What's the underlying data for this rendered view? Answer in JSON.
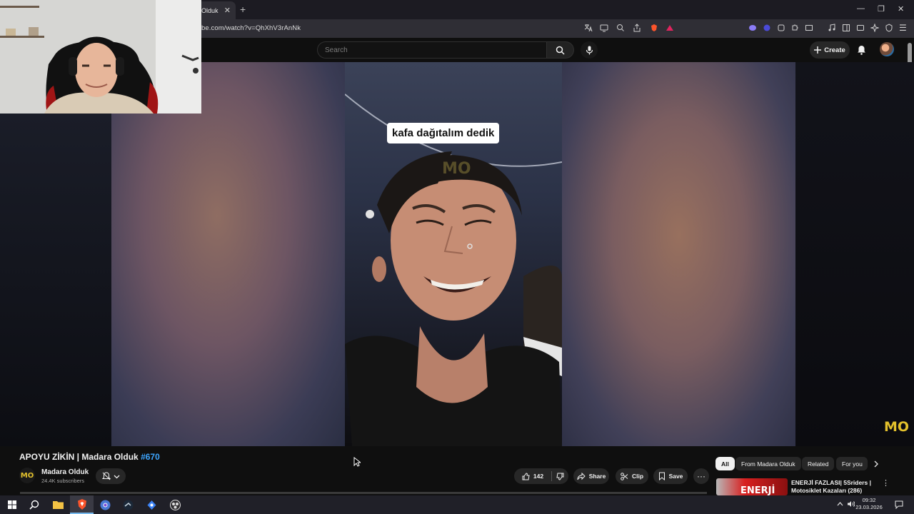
{
  "browser": {
    "tab_title": "Olduk",
    "tab_close": "✕",
    "new_tab": "+",
    "url": "be.com/watch?v=QhXhV3rAnNk",
    "window_controls": [
      "—",
      "❐",
      "✕"
    ],
    "menu_icon": "☰"
  },
  "youtube_header": {
    "search_placeholder": "Search",
    "create_label": "Create"
  },
  "video": {
    "caption": "kafa dağıtalım dedik",
    "watermark": "MO",
    "watermark_corner": "MO"
  },
  "below_video": {
    "title": "APOYU ZİKİN | Madara Olduk",
    "hashtag": "#670",
    "channel_avatar_text": "MO",
    "channel_name": "Madara Olduk",
    "subscribers": "24.4K subscribers",
    "like_count": "142",
    "share_label": "Share",
    "clip_label": "Clip",
    "save_label": "Save",
    "more_label": "···"
  },
  "chips": [
    "All",
    "From Madara Olduk",
    "Related",
    "For you"
  ],
  "related": {
    "thumb_text": "ENERJİ",
    "title": "ENERJİ FAZLASI| 5Sriders | Motosiklet Kazaları (286)",
    "more": "⋮"
  },
  "taskbar": {
    "time": "09:32",
    "date": "23.03.2026"
  },
  "icons": [
    "translate-icon",
    "cast-icon",
    "zoom-icon",
    "share-icon",
    "brave-shield-icon",
    "brave-rewards-icon",
    "extensions-icon",
    "search-icon",
    "mic-icon",
    "plus-icon",
    "bell-icon",
    "like-icon",
    "dislike-icon",
    "share-arrow-icon",
    "scissors-icon",
    "bookmark-icon",
    "bell-off-icon",
    "chevron-down-icon",
    "windows-start-icon",
    "taskbar-search-icon",
    "folder-icon",
    "brave-icon",
    "chrome-icon",
    "steam-icon",
    "app-icon",
    "notification-icon"
  ]
}
